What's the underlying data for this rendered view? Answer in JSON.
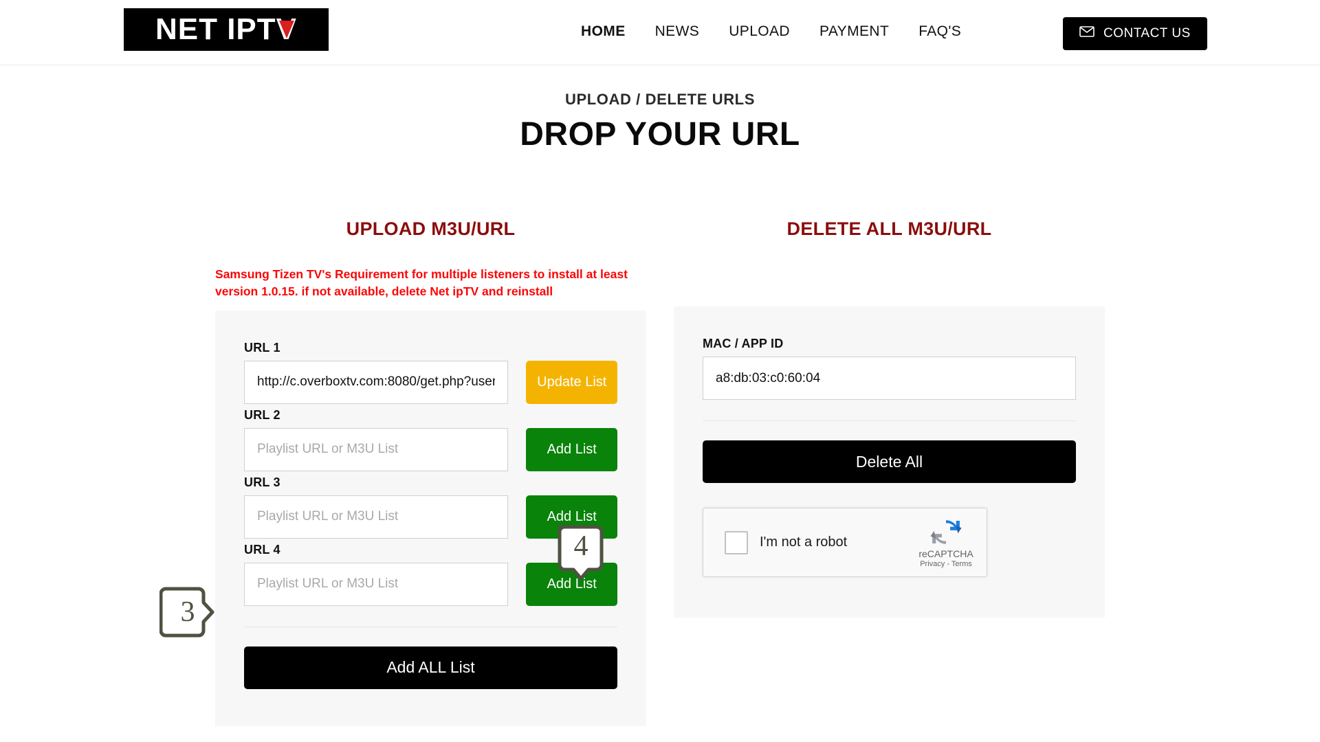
{
  "header": {
    "logo": {
      "text_main": "NET IPT",
      "text_v": "V",
      "icon": "triangle-play-icon"
    },
    "nav": [
      {
        "label": "HOME",
        "active": true
      },
      {
        "label": "NEWS",
        "active": false
      },
      {
        "label": "UPLOAD",
        "active": false
      },
      {
        "label": "PAYMENT",
        "active": false
      },
      {
        "label": "FAQ'S",
        "active": false
      }
    ],
    "contact": {
      "label": "CONTACT US",
      "icon": "envelope-icon"
    }
  },
  "page": {
    "eyebrow": "UPLOAD / DELETE URLS",
    "title": "DROP YOUR URL"
  },
  "upload": {
    "title": "UPLOAD M3U/URL",
    "warning": "Samsung Tizen TV's Requirement for multiple listeners to install at least version 1.0.15. if not available, delete Net ipTV and reinstall",
    "rows": [
      {
        "label": "URL 1",
        "value": "http://c.overboxtv.com:8080/get.php?user",
        "placeholder": "Playlist URL or M3U List",
        "button": "Update List",
        "button_style": "amber"
      },
      {
        "label": "URL 2",
        "value": "",
        "placeholder": "Playlist URL or M3U List",
        "button": "Add List",
        "button_style": "green"
      },
      {
        "label": "URL 3",
        "value": "",
        "placeholder": "Playlist URL or M3U List",
        "button": "Add List",
        "button_style": "green"
      },
      {
        "label": "URL 4",
        "value": "",
        "placeholder": "Playlist URL or M3U List",
        "button": "Add List",
        "button_style": "green"
      }
    ],
    "add_all_label": "Add ALL List"
  },
  "delete": {
    "title": "DELETE ALL M3U/URL",
    "mac_label": "MAC / APP ID",
    "mac_value": "a8:db:03:c0:60:04",
    "mac_placeholder": "MAC / APP ID",
    "delete_all_label": "Delete All",
    "recaptcha": {
      "label": "I'm not a robot",
      "brand": "reCAPTCHA",
      "terms": "Privacy - Terms",
      "icon": "recaptcha-logo-icon"
    }
  },
  "annotations": [
    {
      "number": "3",
      "direction": "right",
      "target": "url-1-input"
    },
    {
      "number": "4",
      "direction": "down",
      "target": "update-list-button"
    }
  ],
  "colors": {
    "accent_red": "#8b0d0d",
    "warning_red": "#fb0606",
    "amber": "#f5b301",
    "green": "#098309",
    "black": "#000000",
    "panel_bg": "#f7f7f7",
    "annotation": "#4e5241"
  }
}
